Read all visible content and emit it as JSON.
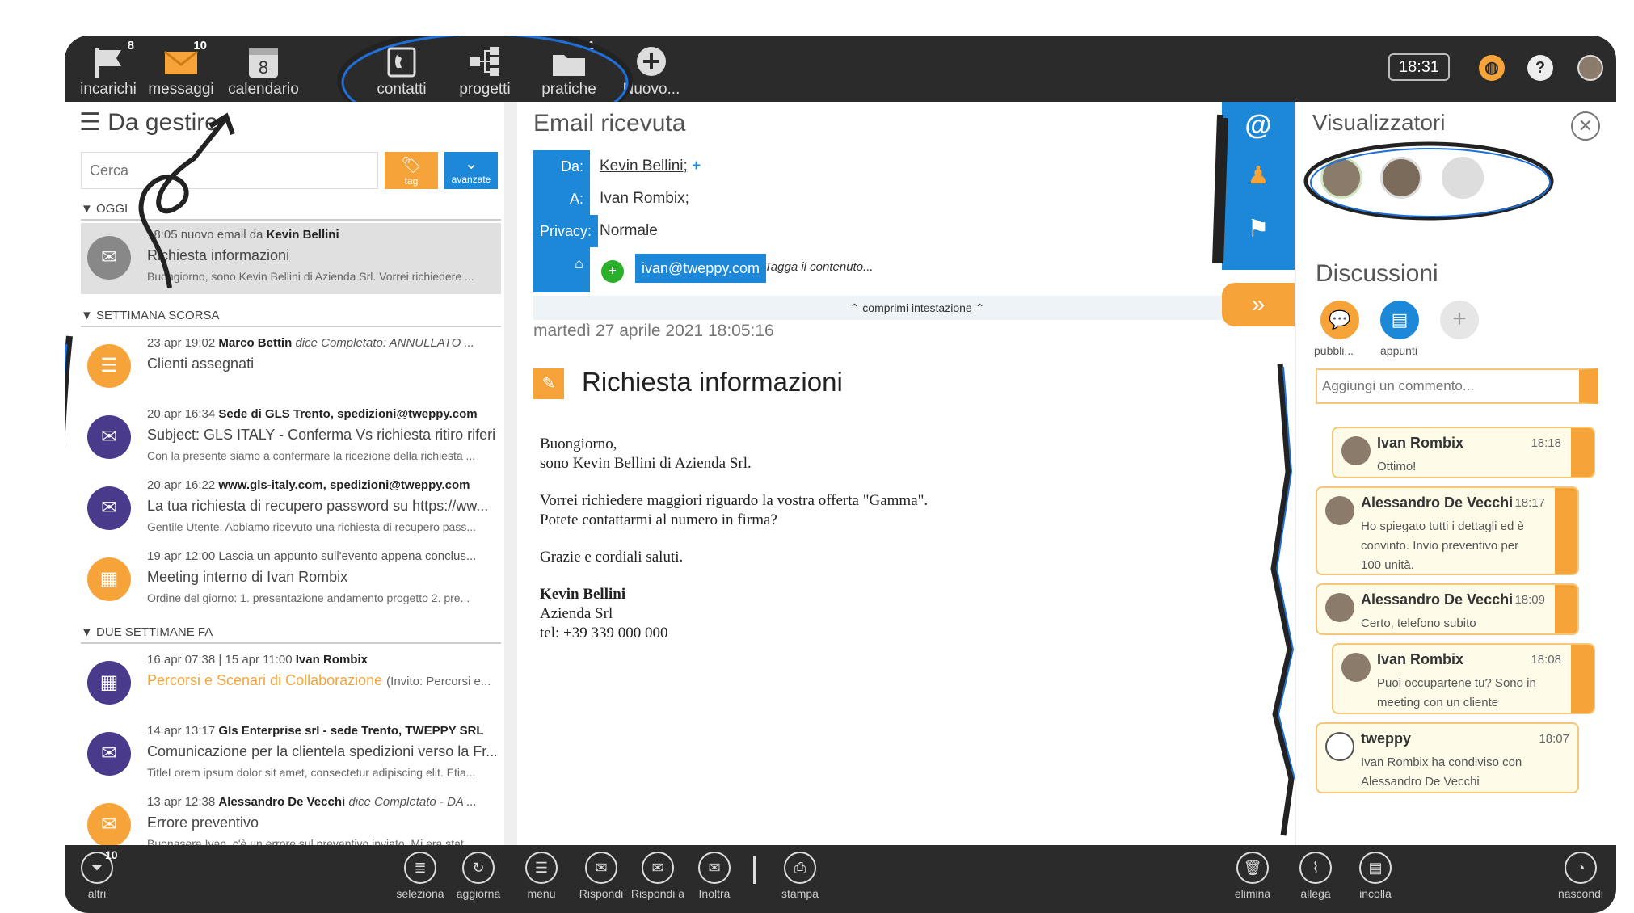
{
  "topbar": {
    "items": [
      {
        "label": "incarichi",
        "badge": "8"
      },
      {
        "label": "messaggi",
        "badge": "10"
      },
      {
        "label": "calendario",
        "badge": "8"
      },
      {
        "label": "contatti",
        "badge": ""
      },
      {
        "label": "progetti",
        "badge": ""
      },
      {
        "label": "pratiche",
        "badge": "1"
      },
      {
        "label": "Nuovo...",
        "badge": ""
      }
    ],
    "time": "18:31",
    "help": "?"
  },
  "left": {
    "title": "Da gestire",
    "search_placeholder": "Cerca",
    "tag_btn": "tag",
    "adv_btn": "avanzate",
    "sections": [
      "OGGI",
      "SETTIMANA SCORSA",
      "DUE SETTIMANE FA"
    ],
    "items": [
      {
        "l1a": "18:05 nuovo email da",
        "l1b": "Kevin Bellini",
        "l2": "Richiesta informazioni",
        "l3": "Buongiorno, sono Kevin Bellini di Azienda Srl. Vorrei richiedere ..."
      },
      {
        "l1a": "23 apr 19:02",
        "l1b": "Marco Bettin",
        "l1c": "dice Completato: ANNULLATO ...",
        "l2": "Clienti assegnati",
        "l3": ""
      },
      {
        "l1a": "20 apr 16:34",
        "l1b": "Sede di GLS Trento, spedizioni@tweppy.com",
        "l2": "Subject: GLS ITALY - Conferma Vs richiesta ritiro riferi...",
        "l3": "Con la presente siamo a confermare la ricezione della richiesta ..."
      },
      {
        "l1a": "20 apr 16:22",
        "l1b": "www.gls-italy.com, spedizioni@tweppy.com",
        "l2": "La tua richiesta di recupero password su https://ww...",
        "l3": "Gentile Utente, Abbiamo ricevuto una richiesta di recupero pass..."
      },
      {
        "l1a": "19 apr 12:00 Lascia un appunto sull'evento appena conclus...",
        "l1b": "",
        "l2": "Meeting interno di Ivan Rombix",
        "l3": "Ordine del giorno: 1. presentazione andamento progetto 2. pre..."
      },
      {
        "l1a": "16 apr 07:38 | 15 apr 11:00",
        "l1b": "Ivan Rombix",
        "l2": "Percorsi e Scenari di Collaborazione",
        "l2b": "(Invito: Percorsi e...",
        "l3": ""
      },
      {
        "l1a": "14 apr 13:17",
        "l1b": "Gls Enterprise srl - sede Trento, TWEPPY SRL",
        "l2": "Comunicazione per la clientela spedizioni verso la Fr...",
        "l3": "TitleLorem ipsum dolor sit amet, consectetur adipiscing elit. Etia..."
      },
      {
        "l1a": "13 apr 12:38",
        "l1b": "Alessandro De Vecchi",
        "l1c": "dice Completato - DA ...",
        "l2": "Errore preventivo",
        "l3": "Buonasera Ivan, c'è un errore sul preventivo inviato. Mi era stat..."
      }
    ]
  },
  "center": {
    "title": "Email ricevuta",
    "da_label": "Da:",
    "da_value": "Kevin Bellini;",
    "a_label": "A:",
    "a_value": "Ivan Rombix;",
    "privacy_label": "Privacy:",
    "privacy_value": "Normale",
    "tag_chip": "ivan@tweppy.com",
    "tag_placeholder": "Tagga il contenuto...",
    "collapse": "comprimi intestazione",
    "date": "martedì 27 aprile 2021 18:05:16",
    "subject": "Richiesta informazioni",
    "body": [
      "Buongiorno,",
      "sono Kevin Bellini di Azienda Srl.",
      "Vorrei richiedere maggiori riguardo la vostra offerta \"Gamma\".",
      "Potete contattarmi al numero in firma?",
      "Grazie e cordiali saluti.",
      "Kevin Bellini",
      "Azienda Srl",
      "tel: +39 339 000 000"
    ]
  },
  "right": {
    "viewers_title": "Visualizzatori",
    "discussions_title": "Discussioni",
    "pub_label": "pubbli...",
    "notes_label": "appunti",
    "comment_placeholder": "Aggiungi un commento...",
    "comments": [
      {
        "who": "Ivan Rombix",
        "time": "18:18",
        "text": "Ottimo!"
      },
      {
        "who": "Alessandro De Vecchi",
        "time": "18:17",
        "text": "Ho spiegato tutti i dettagli ed è convinto. Invio preventivo per 100 unità."
      },
      {
        "who": "Alessandro De Vecchi",
        "time": "18:09",
        "text": "Certo, telefono subito"
      },
      {
        "who": "Ivan Rombix",
        "time": "18:08",
        "text": "Puoi occupartene tu? Sono in meeting con un cliente"
      },
      {
        "who": "tweppy",
        "time": "18:07",
        "text": "Ivan Rombix ha condiviso con Alessandro De Vecchi"
      }
    ]
  },
  "bottombar": {
    "altri": "altri",
    "altri_badge": "10",
    "items": [
      "seleziona",
      "aggiorna",
      "menu",
      "Rispondi",
      "Rispondi a",
      "Inoltra",
      "stampa"
    ],
    "right_items": [
      "elimina",
      "allega",
      "incolla",
      "nascondi"
    ]
  },
  "colors": {
    "accent_orange": "#f6a43a",
    "accent_blue": "#1e88d8",
    "purple": "#4a3a8c",
    "dark_bar": "#2b2b2b"
  }
}
